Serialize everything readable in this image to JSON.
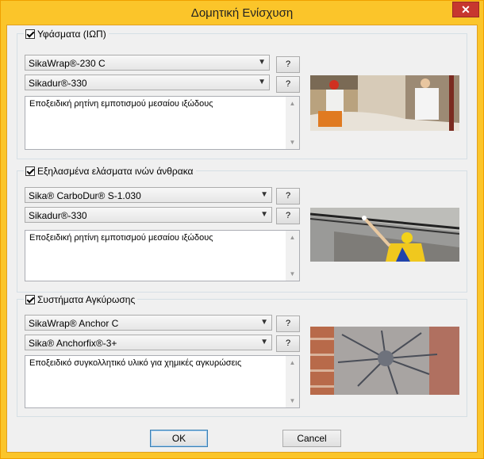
{
  "window": {
    "title": "Δομητική Ενίσχυση",
    "close_glyph": "✕"
  },
  "groups": [
    {
      "checked": true,
      "label": "Υφάσματα (ΙΩΠ)",
      "combo1": "SikaWrap®-230 C",
      "combo2": "Sikadur®-330",
      "help_label": "?",
      "description": "Εποξειδική ρητίνη εμποτισμού μεσαίου ιξώδους"
    },
    {
      "checked": true,
      "label": "Εξηλασμένα ελάσματα ινών άνθρακα",
      "combo1": "Sika® CarboDur® S-1.030",
      "combo2": "Sikadur®-330",
      "help_label": "?",
      "description": "Εποξειδική ρητίνη εμποτισμού μεσαίου ιξώδους"
    },
    {
      "checked": true,
      "label": "Συστήματα Αγκύρωσης",
      "combo1": "SikaWrap® Anchor C",
      "combo2": "Sika® Anchorfix®-3+",
      "help_label": "?",
      "description": "Εποξειδικό συγκολλητικό υλικό για χημικές αγκυρώσεις"
    }
  ],
  "buttons": {
    "ok": "OK",
    "cancel": "Cancel"
  },
  "colors": {
    "accent_frame": "#fbc52a",
    "close": "#c7372f"
  }
}
